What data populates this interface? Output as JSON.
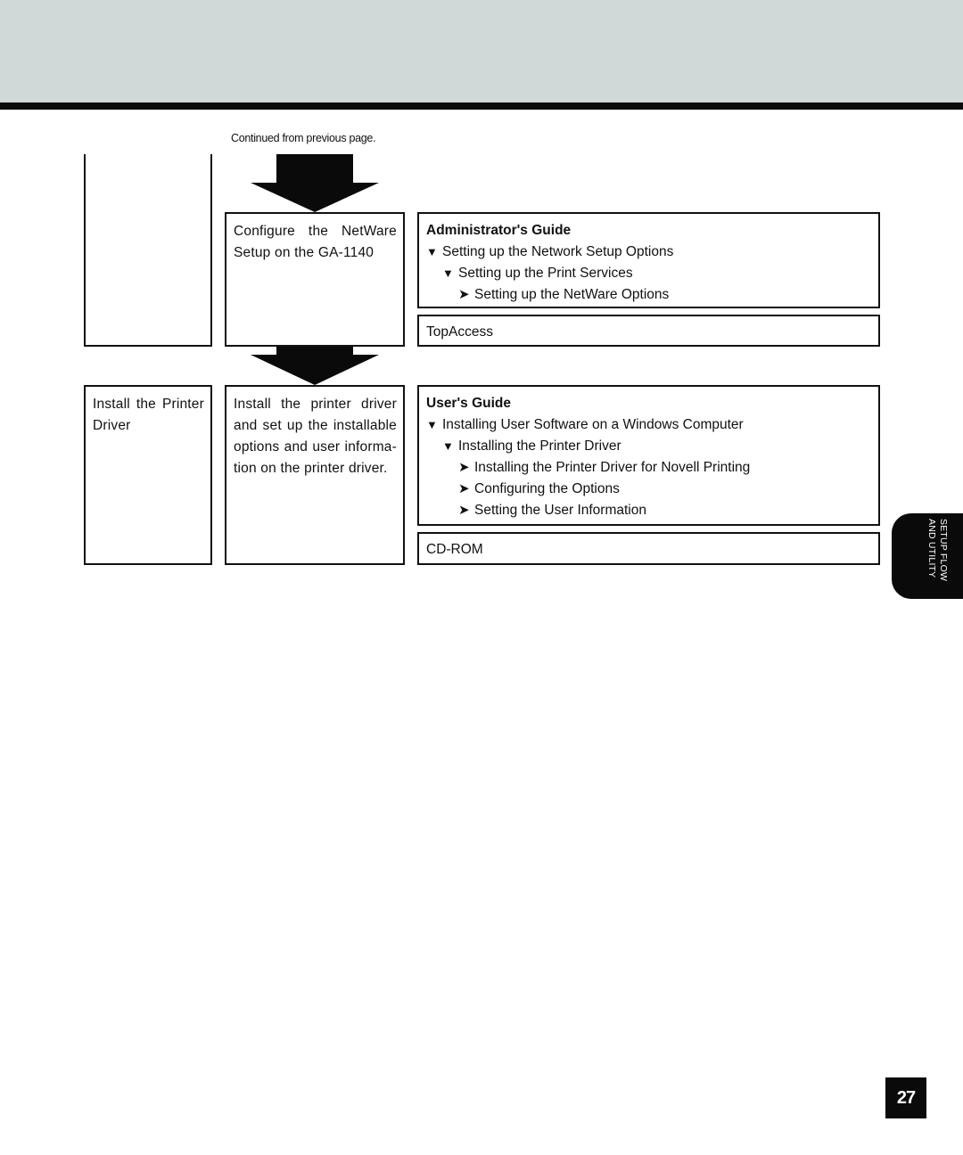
{
  "header": {
    "band_color": "#d0d9d8",
    "rule_color": "#0a0c0b"
  },
  "continued_note": "Continued from previous page.",
  "flow": {
    "row1": {
      "left_label": "",
      "step": {
        "lines": [
          "Configure the NetWare",
          "Setup on the GA-1140"
        ]
      },
      "reference": {
        "title": "Administrator's Guide",
        "items": [
          {
            "level": 1,
            "marker": "▼",
            "text": "Setting up the Network Setup Options"
          },
          {
            "level": 2,
            "marker": "▼",
            "text": "Setting up the Print Services"
          },
          {
            "level": 3,
            "marker": "➤",
            "text": "Setting up the NetWare Options"
          }
        ]
      },
      "tool": "TopAccess"
    },
    "row2": {
      "left_label_lines": [
        "Install the Printer",
        "Driver"
      ],
      "step": {
        "lines": [
          "Install the printer driver",
          "and set up the installable",
          "options and user informa-",
          "tion on the printer driver."
        ]
      },
      "reference": {
        "title": "User's Guide",
        "items": [
          {
            "level": 1,
            "marker": "▼",
            "text": "Installing User Software on a Windows Computer"
          },
          {
            "level": 2,
            "marker": "▼",
            "text": "Installing the Printer Driver"
          },
          {
            "level": 3,
            "marker": "➤",
            "text": "Installing the Printer Driver for Novell Printing"
          },
          {
            "level": 3,
            "marker": "➤",
            "text": "Configuring the Options"
          },
          {
            "level": 3,
            "marker": "➤",
            "text": "Setting the User Information"
          }
        ]
      },
      "tool": "CD-ROM"
    }
  },
  "side_tab": {
    "line1": "SETUP FLOW",
    "line2": "AND UTILITY"
  },
  "page_number": "27"
}
